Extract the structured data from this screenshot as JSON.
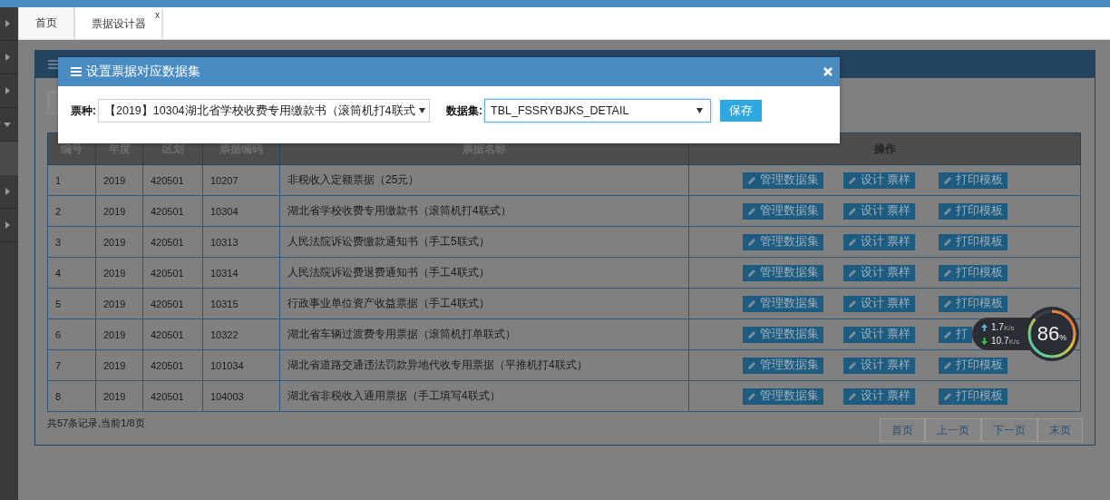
{
  "sidebar": {
    "items": [
      {
        "expanded": false
      },
      {
        "expanded": false
      },
      {
        "expanded": false
      },
      {
        "expanded": true
      },
      {
        "expanded": false
      },
      {
        "expanded": false
      }
    ]
  },
  "tabs": [
    {
      "label": "首页",
      "selected": false
    },
    {
      "label": "票据设计器",
      "selected": true,
      "close": "x"
    }
  ],
  "table": {
    "columns": [
      "编号",
      "年度",
      "区划",
      "票据编码",
      "票据名称",
      "操作"
    ],
    "rows": [
      {
        "cells": [
          "1",
          "2019",
          "420501",
          "10207",
          "非税收入定额票据（25元）"
        ],
        "actions": [
          "管理数据集",
          "设计 票样",
          "打印模板"
        ]
      },
      {
        "cells": [
          "2",
          "2019",
          "420501",
          "10304",
          "湖北省学校收费专用缴款书（滚筒机打4联式）"
        ],
        "actions": [
          "管理数据集",
          "设计 票样",
          "打印模板"
        ]
      },
      {
        "cells": [
          "3",
          "2019",
          "420501",
          "10313",
          "人民法院诉讼费缴款通知书（手工5联式）"
        ],
        "actions": [
          "管理数据集",
          "设计 票样",
          "打印模板"
        ]
      },
      {
        "cells": [
          "4",
          "2019",
          "420501",
          "10314",
          "人民法院诉讼费退费通知书（手工4联式）"
        ],
        "actions": [
          "管理数据集",
          "设计 票样",
          "打印模板"
        ]
      },
      {
        "cells": [
          "5",
          "2019",
          "420501",
          "10315",
          "行政事业单位资产收益票据（手工4联式）"
        ],
        "actions": [
          "管理数据集",
          "设计 票样",
          "打印模板"
        ]
      },
      {
        "cells": [
          "6",
          "2019",
          "420501",
          "10322",
          "湖北省车辆过渡费专用票据（滚筒机打单联式）"
        ],
        "actions": [
          "管理数据集",
          "设计 票样",
          "打"
        ]
      },
      {
        "cells": [
          "7",
          "2019",
          "420501",
          "101034",
          "湖北省道路交通违法罚款异地代收专用票据（平推机打4联式）"
        ],
        "actions": [
          "管理数据集",
          "设计 票样",
          "打印模板"
        ]
      },
      {
        "cells": [
          "8",
          "2019",
          "420501",
          "104003",
          "湖北省非税收入通用票据（手工填写4联式）"
        ],
        "actions": [
          "管理数据集",
          "设计 票样",
          "打印模板"
        ]
      }
    ]
  },
  "footer": {
    "summary": "共57条记录,当前1/8页",
    "pager": [
      "首页",
      "上一页",
      "下一页",
      "末页"
    ]
  },
  "dialog": {
    "title": "设置票据对应数据集",
    "fields": [
      {
        "label": "票种:",
        "value": "【2019】10304湖北省学校收费专用缴款书（滚筒机打4联式",
        "focused": false
      },
      {
        "label": "数据集:",
        "value": "TBL_FSSRYBJKS_DETAIL",
        "focused": true
      }
    ],
    "button": "保存"
  },
  "net_widget": {
    "upload": "1.7",
    "upload_unit": "K/s",
    "download": "10.7",
    "download_unit": "K/s",
    "percent": "86",
    "percent_sign": "%"
  }
}
